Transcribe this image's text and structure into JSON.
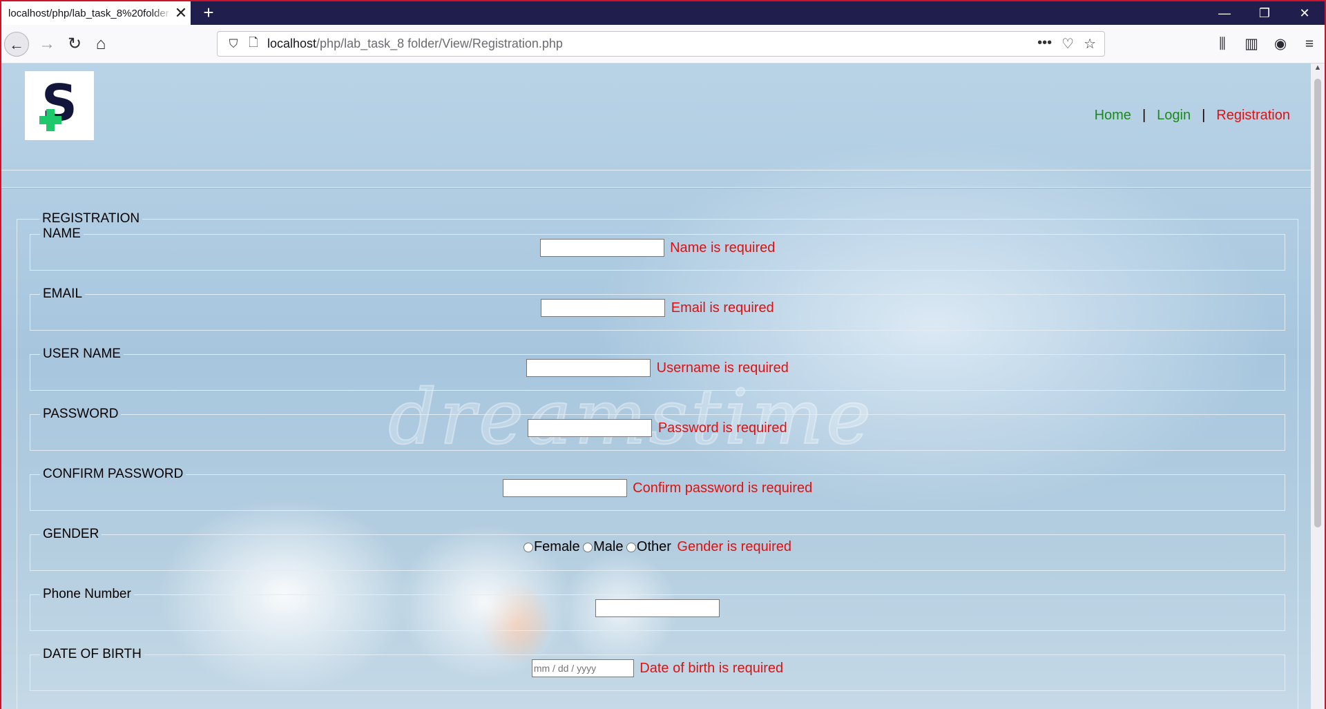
{
  "browser": {
    "tab_title": "localhost/php/lab_task_8%20folder",
    "tab_close": "✕",
    "new_tab": "+",
    "url_host": "localhost",
    "url_path": "/php/lab_task_8 folder/View/Registration.php",
    "window_controls": {
      "minimize": "—",
      "restore": "❐",
      "close": "✕"
    },
    "nav_icons": {
      "back": "←",
      "forward": "→",
      "reload": "↻",
      "home": "⌂"
    },
    "url_icons": {
      "shield": "⛉",
      "page": "🗋",
      "more": "•••",
      "pocket": "♡",
      "bookmark": "☆"
    },
    "tool_icons": {
      "library": "⫼",
      "sidebar": "▥",
      "account": "◉",
      "menu": "≡"
    }
  },
  "site": {
    "logo_letter": "S",
    "nav": {
      "home": "Home",
      "login": "Login",
      "registration": "Registration",
      "separator": "|"
    }
  },
  "watermark": "dreamstime",
  "form": {
    "legend": "REGISTRATION",
    "fields": {
      "name": {
        "label": "NAME",
        "value": "",
        "error": "Name is required"
      },
      "email": {
        "label": "EMAIL",
        "value": "",
        "error": "Email is required"
      },
      "username": {
        "label": "USER NAME",
        "value": "",
        "error": "Username is required"
      },
      "password": {
        "label": "PASSWORD",
        "value": "",
        "error": "Password is required"
      },
      "confirm_password": {
        "label": "CONFIRM PASSWORD",
        "value": "",
        "error": "Confirm password is required"
      },
      "gender": {
        "label": "GENDER",
        "options": [
          "Female",
          "Male",
          "Other"
        ],
        "error": "Gender is required"
      },
      "phone": {
        "label": "Phone Number",
        "value": ""
      },
      "dob": {
        "label": "DATE OF BIRTH",
        "placeholder": "mm / dd / yyyy",
        "error": "Date of birth is required"
      }
    }
  }
}
